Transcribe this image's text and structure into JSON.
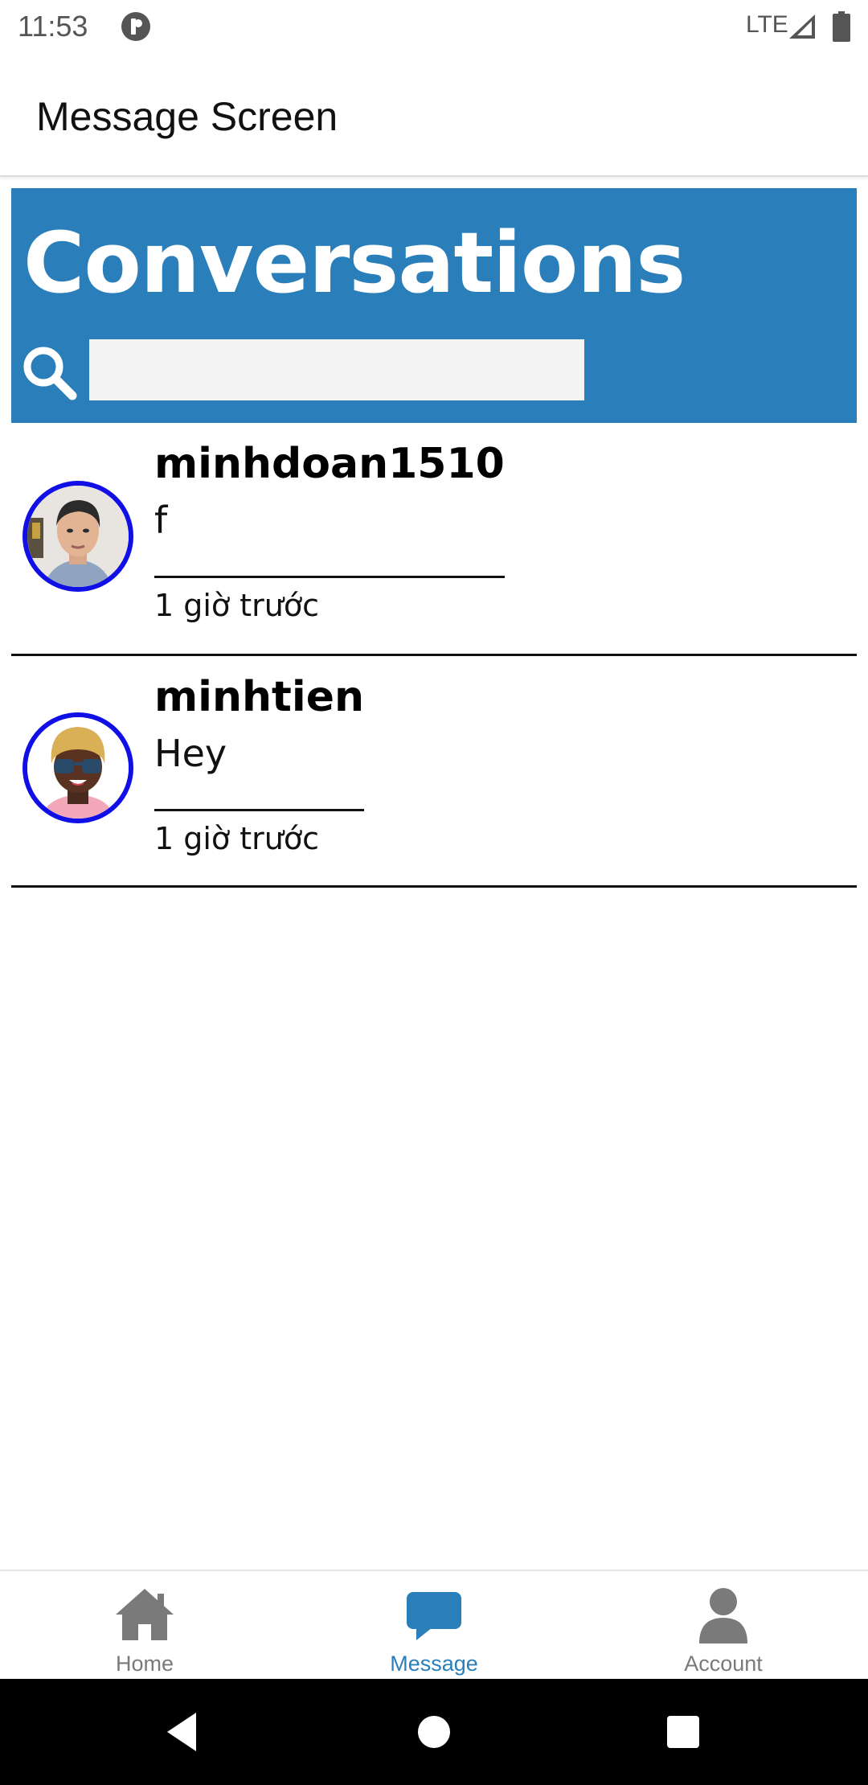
{
  "status_bar": {
    "time": "11:53",
    "network": "LTE"
  },
  "app_bar": {
    "title": "Message Screen"
  },
  "conversations": {
    "title": "Conversations",
    "search": {
      "value": "",
      "placeholder": ""
    },
    "items": [
      {
        "name": "minhdoan1510",
        "last_message": "f",
        "time": "1 giờ trước"
      },
      {
        "name": "minhtien",
        "last_message": "Hey",
        "time": "1 giờ trước"
      }
    ]
  },
  "bottom_nav": {
    "tabs": [
      {
        "label": "Home",
        "icon": "home-icon",
        "active": false
      },
      {
        "label": "Message",
        "icon": "message-icon",
        "active": true
      },
      {
        "label": "Account",
        "icon": "account-icon",
        "active": false
      }
    ]
  },
  "colors": {
    "header_blue": "#2a7fba",
    "avatar_border": "#1010e6",
    "nav_active": "#2a7fba",
    "nav_inactive": "#7a7a7a"
  }
}
